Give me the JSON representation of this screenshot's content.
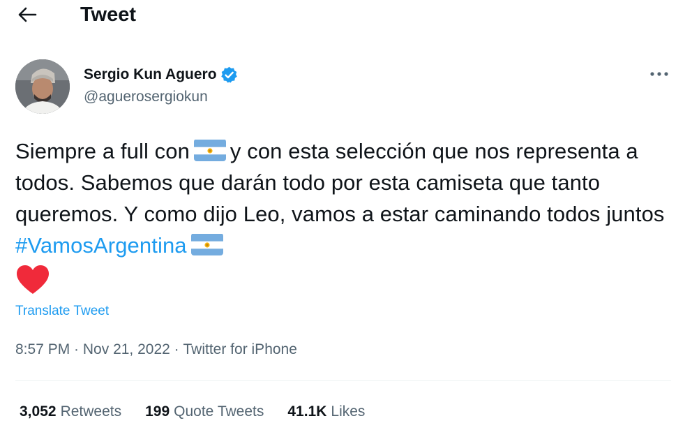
{
  "header": {
    "title": "Tweet",
    "back_icon": "arrow-left-icon"
  },
  "author": {
    "display_name": "Sergio Kun Aguero",
    "handle": "@aguerosergiokun",
    "verified_icon": "verified-badge-icon",
    "more_icon": "more-horizontal-icon"
  },
  "tweet": {
    "text_1": "Siempre a full con",
    "text_2": "y con esta selección que nos representa a todos. Sabemos que darán todo por esta camiseta que tanto queremos. Y como dijo Leo, vamos a estar caminando todos juntos",
    "hashtag": "#VamosArgentina",
    "emoji_flag": "argentina-flag-icon",
    "emoji_heart": "red-heart-icon",
    "translate_label": "Translate Tweet"
  },
  "meta": {
    "time": "8:57 PM",
    "separator": " · ",
    "date": "Nov 21, 2022",
    "source": "Twitter for iPhone"
  },
  "stats": {
    "retweets_count": "3,052",
    "retweets_label": "Retweets",
    "quotes_count": "199",
    "quotes_label": "Quote Tweets",
    "likes_count": "41.1K",
    "likes_label": "Likes"
  },
  "colors": {
    "accent": "#1d9bf0",
    "text": "#0f1419",
    "secondary": "#536471",
    "flag_blue": "#74acdf",
    "heart": "#f02a3a"
  }
}
